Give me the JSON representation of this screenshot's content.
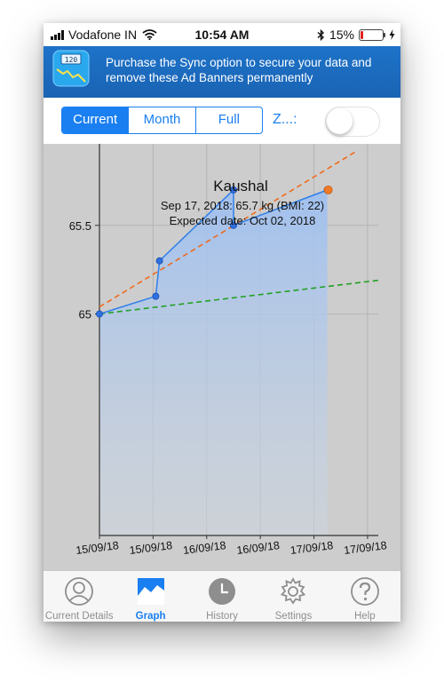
{
  "status_bar": {
    "carrier": "Vodafone IN",
    "time": "10:54 AM",
    "battery_percent": "15%",
    "battery_level": 0.15
  },
  "banner": {
    "icon_text": "120",
    "text": "Purchase the Sync option to secure your data and remove these Ad Banners permanently"
  },
  "controls": {
    "segments": [
      "Current",
      "Month",
      "Full"
    ],
    "active_segment": 0,
    "zoom_label": "Z...:",
    "zoom_on": false
  },
  "chart_data": {
    "type": "line",
    "title": "Kaushal",
    "annotations": [
      "Sep 17, 2018: 65.7 kg (BMI: 22)",
      "Expected date: Oct 02, 2018"
    ],
    "x_tick_labels": [
      "15/09/18",
      "15/09/18",
      "16/09/18",
      "16/09/18",
      "17/09/18",
      "17/09/18"
    ],
    "x_range": [
      0,
      5.2
    ],
    "y_range": [
      63.75,
      65.96
    ],
    "y_ticks": [
      65,
      65.5
    ],
    "grid": true,
    "series": [
      {
        "points": [
          {
            "x": 0,
            "y": 65.0
          },
          {
            "x": 1.05,
            "y": 65.1
          },
          {
            "x": 1.12,
            "y": 65.3
          },
          {
            "x": 2.5,
            "y": 65.7
          },
          {
            "x": 2.5,
            "y": 65.5
          },
          {
            "x": 4.25,
            "y": 65.7
          }
        ]
      }
    ],
    "trend_lines": [
      {
        "color": "#f06a1c",
        "from": {
          "x": 0,
          "y": 65.04
        },
        "to": {
          "x": 4.8,
          "y": 65.92
        }
      },
      {
        "color": "#22a022",
        "from": {
          "x": 0,
          "y": 65.0
        },
        "to": {
          "x": 5.2,
          "y": 65.19
        }
      }
    ],
    "highlight_point": {
      "x": 4.25,
      "y": 65.7
    }
  },
  "tabbar": {
    "tabs": [
      {
        "label": "Current Details",
        "icon": "person-icon"
      },
      {
        "label": "Graph",
        "icon": "graph-icon"
      },
      {
        "label": "History",
        "icon": "clock-icon"
      },
      {
        "label": "Settings",
        "icon": "gear-icon"
      },
      {
        "label": "Help",
        "icon": "help-icon"
      }
    ],
    "active_tab": 1
  },
  "colors": {
    "accent": "#1a7ff0",
    "banner": "#1a63b3",
    "chart_background": "#cdcdcd",
    "series_line": "#2f7fe8",
    "series_fill": "#a9c8f0"
  }
}
